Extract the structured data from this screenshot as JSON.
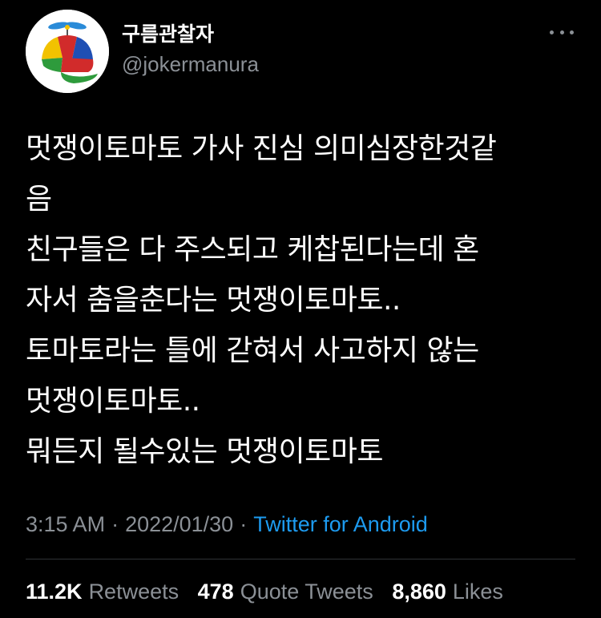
{
  "author": {
    "display_name": "구름관찰자",
    "handle": "@jokermanura",
    "avatar_icon": "propeller-beanie-cap-icon"
  },
  "menu": {
    "icon": "more-options-icon"
  },
  "tweet": {
    "lines": [
      "멋쟁이토마토 가사 진심 의미심장한것같",
      "음",
      "친구들은 다 주스되고 케찹된다는데 혼",
      "자서 춤을춘다는 멋쟁이토마토..",
      "토마토라는 틀에 갇혀서 사고하지 않는",
      "멋쟁이토마토..",
      "뭐든지 될수있는 멋쟁이토마토"
    ],
    "time": "3:15 AM",
    "separator": "·",
    "date": "2022/01/30",
    "source": "Twitter for Android"
  },
  "stats": {
    "retweets_count": "11.2K",
    "retweets_label": "Retweets",
    "quotes_count": "478",
    "quotes_label": "Quote Tweets",
    "likes_count": "8,860",
    "likes_label": "Likes"
  },
  "colors": {
    "background": "#000000",
    "text": "#ffffff",
    "secondary": "#8b9096",
    "link": "#1d9bf0",
    "divider": "#2f3336"
  }
}
